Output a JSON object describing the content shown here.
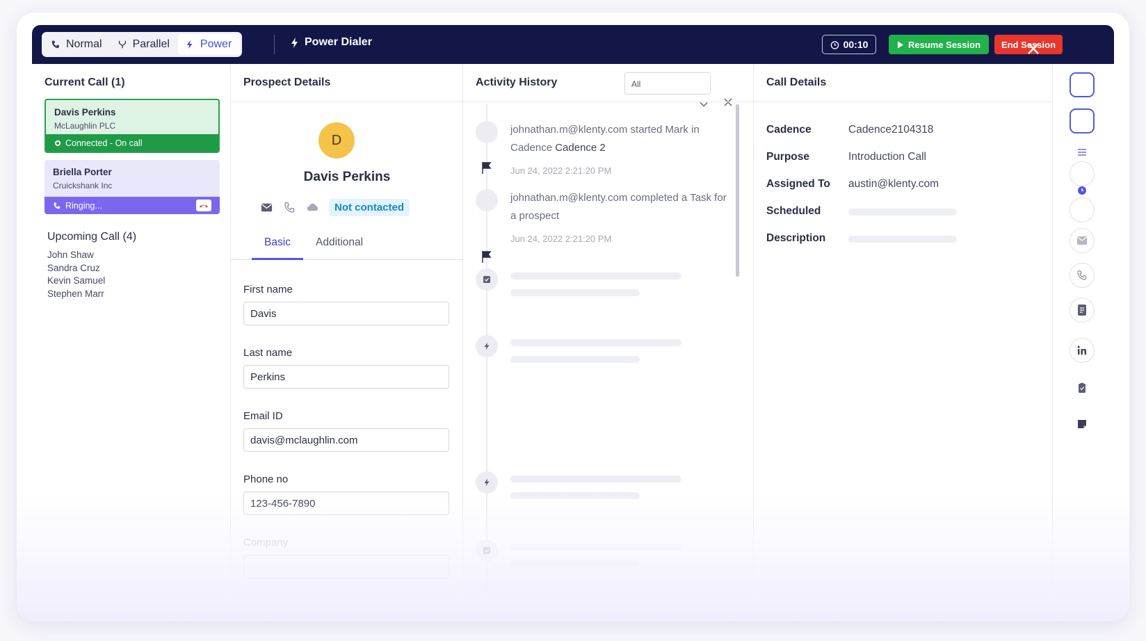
{
  "topbar": {
    "modes": [
      {
        "label": "Normal",
        "icon": "phone-icon"
      },
      {
        "label": "Parallel",
        "icon": "parallel-icon"
      },
      {
        "label": "Power",
        "icon": "bolt-icon"
      }
    ],
    "active_mode": "Power",
    "title": "Power Dialer",
    "timer": "00:10",
    "resume_label": "Resume Session",
    "end_label": "End Session"
  },
  "current_call": {
    "heading": "Current Call (1)",
    "cards": [
      {
        "name": "Davis Perkins",
        "company": "McLaughlin PLC",
        "status": "Connected - On call"
      },
      {
        "name": "Briella Porter",
        "company": "Cruickshank Inc",
        "status": "Ringing..."
      }
    ]
  },
  "upcoming": {
    "heading": "Upcoming Call (4)",
    "names": [
      "John Shaw",
      "Sandra Cruz",
      "Kevin Samuel",
      "Stephen Marr"
    ]
  },
  "prospect": {
    "heading": "Prospect Details",
    "initial": "D",
    "name": "Davis Perkins",
    "status_badge": "Not contacted",
    "tabs": [
      "Basic",
      "Additional"
    ],
    "fields": [
      {
        "label": "First name",
        "value": "Davis"
      },
      {
        "label": "Last name",
        "value": "Perkins"
      },
      {
        "label": "Email ID",
        "value": "davis@mclaughlin.com"
      },
      {
        "label": "Phone no",
        "value": "123-456-7890"
      },
      {
        "label": "Company",
        "value": ""
      }
    ]
  },
  "activity": {
    "heading": "Activity History",
    "filter_value": "All",
    "items": [
      {
        "text_prefix": "johnathan.m@klenty.com started Mark in Cadence ",
        "text_highlight": "Cadence 2",
        "time": "Jun 24, 2022 2:21:20 PM"
      },
      {
        "text_prefix": "johnathan.m@klenty.com completed a Task for a prospect",
        "text_highlight": "",
        "time": "Jun 24, 2022 2:21:20 PM"
      }
    ]
  },
  "call_details": {
    "heading": "Call Details",
    "rows": [
      {
        "label": "Cadence",
        "value": "Cadence2104318"
      },
      {
        "label": "Purpose",
        "value": "Introduction Call"
      },
      {
        "label": "Assigned To",
        "value": "austin@klenty.com"
      },
      {
        "label": "Scheduled",
        "value": ""
      },
      {
        "label": "Description",
        "value": ""
      }
    ]
  },
  "colors": {
    "topbar": "#121747",
    "accent": "#4f55e6",
    "resume": "#22b24c",
    "end": "#e8362c",
    "connected": "#1f9a47",
    "ringing": "#7a67ee"
  }
}
